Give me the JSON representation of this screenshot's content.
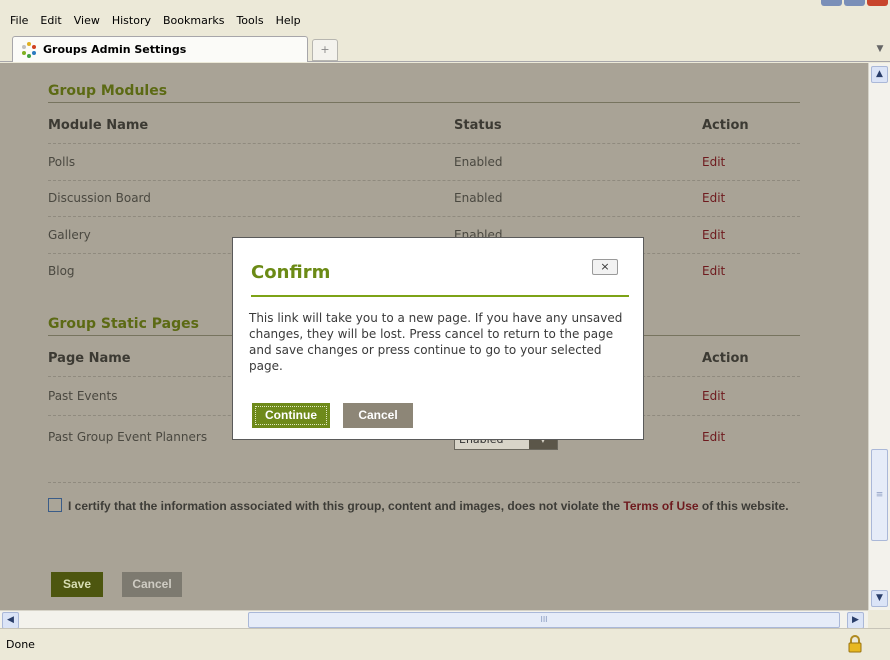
{
  "browser": {
    "menu": [
      "File",
      "Edit",
      "View",
      "History",
      "Bookmarks",
      "Tools",
      "Help"
    ],
    "tab_title": "Groups Admin Settings",
    "new_tab_label": "+",
    "status": "Done"
  },
  "modules_section": {
    "title": "Group Modules",
    "headers": {
      "name": "Module Name",
      "status": "Status",
      "action": "Action"
    },
    "rows": [
      {
        "name": "Polls",
        "status": "Enabled",
        "action": "Edit"
      },
      {
        "name": "Discussion Board",
        "status": "Enabled",
        "action": "Edit"
      },
      {
        "name": "Gallery",
        "status": "Enabled",
        "action": "Edit"
      },
      {
        "name": "Blog",
        "status": "",
        "action": "Edit"
      }
    ]
  },
  "static_section": {
    "title": "Group Static Pages",
    "headers": {
      "name": "Page Name",
      "action": "Action"
    },
    "rows": [
      {
        "name": "Past Events",
        "action": "Edit"
      },
      {
        "name": "Past Group Event Planners",
        "action": "Edit",
        "select_value": "Enabled"
      }
    ]
  },
  "certify": {
    "text_before": "I certify that the information associated with this group, content and images, does not violate the ",
    "link": "Terms of Use",
    "text_after": " of this website.",
    "checked": false
  },
  "form_buttons": {
    "save": "Save",
    "cancel": "Cancel"
  },
  "modal": {
    "title": "Confirm",
    "close_label": "×",
    "body": "This link will take you to a new page. If you have any unsaved changes, they will be lost. Press cancel to return to the page and save changes or press continue to go to your selected page.",
    "continue": "Continue",
    "cancel": "Cancel"
  },
  "colors": {
    "accent": "#6b8a15",
    "link": "#6e1a1e",
    "page_bg": "#a9a396"
  }
}
